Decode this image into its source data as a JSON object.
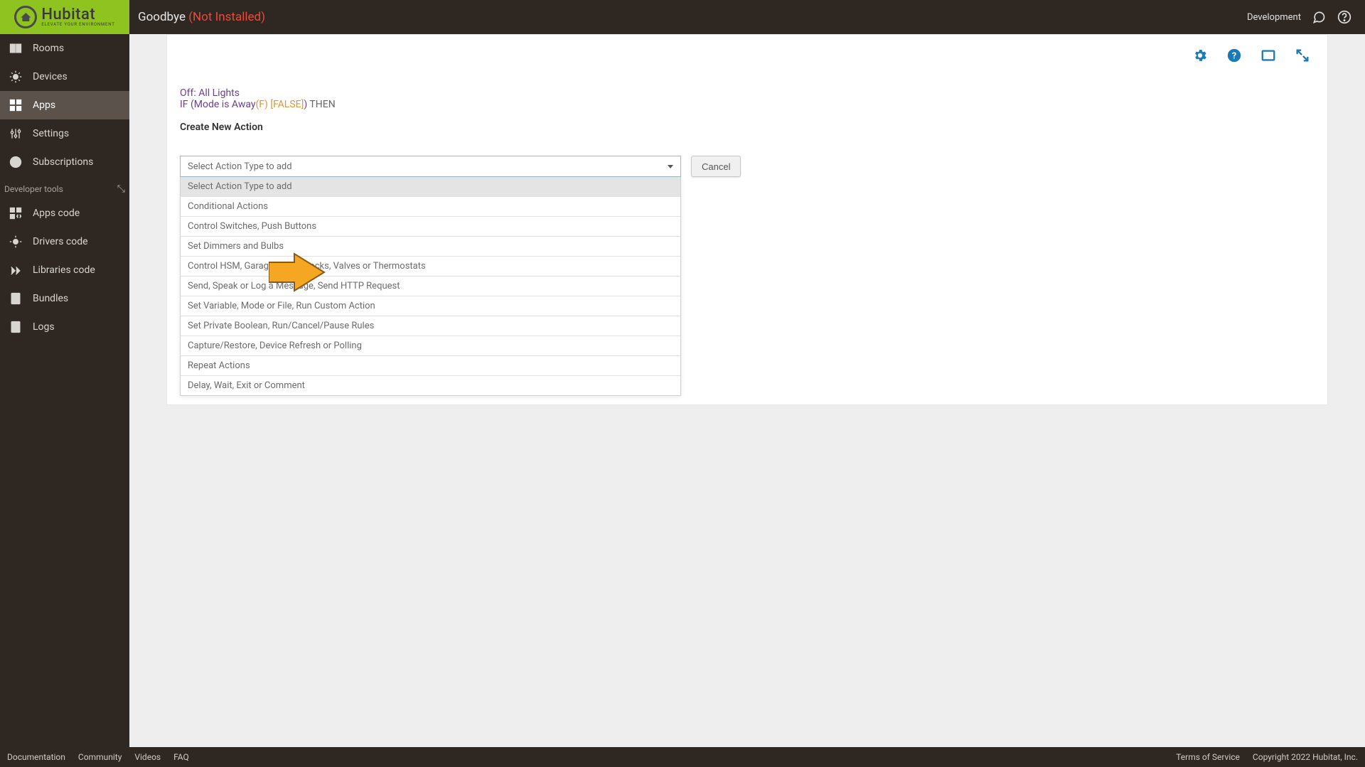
{
  "header": {
    "logo_main": "Hubitat",
    "logo_sub": "ELEVATE YOUR ENVIRONMENT",
    "title": "Goodbye",
    "not_installed": "(Not Installed)",
    "dev_label": "Development"
  },
  "sidebar": {
    "items": [
      "Rooms",
      "Devices",
      "Apps",
      "Settings",
      "Subscriptions"
    ],
    "dev_header": "Developer tools",
    "dev_items": [
      "Apps code",
      "Drivers code",
      "Libraries code",
      "Bundles",
      "Logs"
    ]
  },
  "rule": {
    "line1": "Off: All Lights",
    "line2_a": "IF (Mode is Away",
    "line2_b": "(F) [FALSE]",
    "line2_c": ") ",
    "line2_d": "THEN",
    "create_label": "Create New Action"
  },
  "select": {
    "placeholder": "Select Action Type to add",
    "options": [
      "Select Action Type to add",
      "Conditional Actions",
      "Control Switches, Push Buttons",
      "Set Dimmers and Bulbs",
      "Control HSM, Garage Doors, Locks, Valves or Thermostats",
      "Send, Speak or Log a Message, Send HTTP Request",
      "Set Variable, Mode or File, Run Custom Action",
      "Set Private Boolean, Run/Cancel/Pause Rules",
      "Capture/Restore, Device Refresh or Polling",
      "Repeat Actions",
      "Delay, Wait, Exit or Comment"
    ]
  },
  "buttons": {
    "cancel": "Cancel"
  },
  "footer": {
    "links": [
      "Documentation",
      "Community",
      "Videos",
      "FAQ"
    ],
    "tos": "Terms of Service",
    "copyright": "Copyright 2022 Hubitat, Inc."
  },
  "annotation": {
    "arrow_points_to_option_index": 4
  }
}
